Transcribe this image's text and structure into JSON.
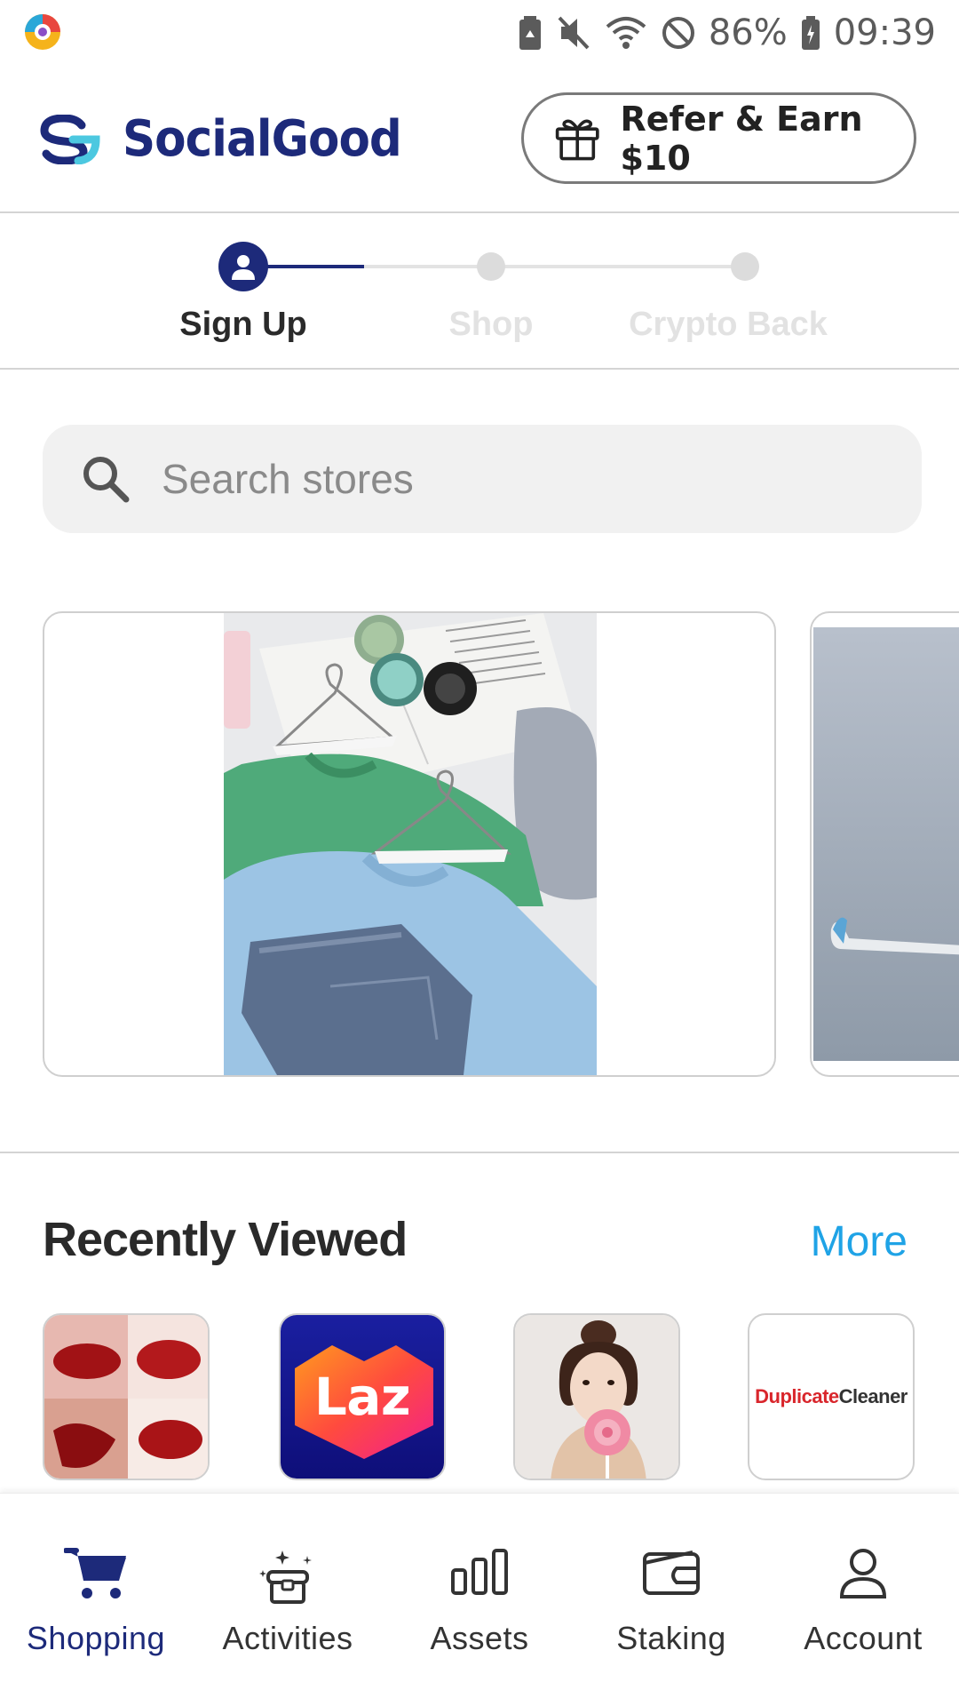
{
  "status_bar": {
    "battery": "86%",
    "time": "09:39"
  },
  "header": {
    "brand": "SocialGood",
    "refer_label": "Refer & Earn $10"
  },
  "stepper": {
    "steps": [
      {
        "label": "Sign Up",
        "state": "active"
      },
      {
        "label": "Shop",
        "state": "inactive"
      },
      {
        "label": "Crypto Back",
        "state": "inactive"
      }
    ]
  },
  "search": {
    "placeholder": "Search stores"
  },
  "recently_viewed": {
    "title": "Recently Viewed",
    "more_label": "More",
    "items": [
      {
        "name": "lip tint store",
        "text": ""
      },
      {
        "name": "Lazada",
        "text": "Laz"
      },
      {
        "name": "fashion store",
        "text": ""
      },
      {
        "name": "DuplicateCleaner",
        "text_red": "Duplicate",
        "text_dark": "Cleaner"
      }
    ]
  },
  "bottom_nav": {
    "items": [
      {
        "label": "Shopping",
        "icon": "cart-icon",
        "active": true
      },
      {
        "label": "Activities",
        "icon": "activities-icon",
        "active": false
      },
      {
        "label": "Assets",
        "icon": "assets-icon",
        "active": false
      },
      {
        "label": "Staking",
        "icon": "wallet-icon",
        "active": false
      },
      {
        "label": "Account",
        "icon": "account-icon",
        "active": false
      }
    ]
  },
  "colors": {
    "brand": "#1d2a7a",
    "link": "#1fa3e6",
    "inactive_step": "#e2e2e2"
  }
}
